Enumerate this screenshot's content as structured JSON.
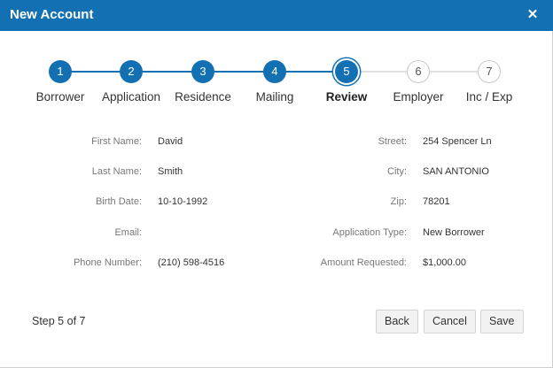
{
  "dialog": {
    "title": "New Account",
    "close_glyph": "✕"
  },
  "stepper": {
    "current_step": 5,
    "steps": [
      {
        "number": "1",
        "label": "Borrower",
        "state": "done"
      },
      {
        "number": "2",
        "label": "Application",
        "state": "done"
      },
      {
        "number": "3",
        "label": "Residence",
        "state": "done"
      },
      {
        "number": "4",
        "label": "Mailing",
        "state": "done"
      },
      {
        "number": "5",
        "label": "Review",
        "state": "current"
      },
      {
        "number": "6",
        "label": "Employer",
        "state": "todo"
      },
      {
        "number": "7",
        "label": "Inc / Exp",
        "state": "todo"
      }
    ]
  },
  "review": {
    "left": [
      {
        "label": "First Name:",
        "value": "David"
      },
      {
        "label": "Last Name:",
        "value": "Smith"
      },
      {
        "label": "Birth Date:",
        "value": "10-10-1992"
      },
      {
        "label": "Email:",
        "value": ""
      },
      {
        "label": "Phone Number:",
        "value": "(210) 598-4516"
      }
    ],
    "right": [
      {
        "label": "Street:",
        "value": "254 Spencer Ln"
      },
      {
        "label": "City:",
        "value": "SAN ANTONIO"
      },
      {
        "label": "Zip:",
        "value": "78201"
      },
      {
        "label": "Application Type:",
        "value": "New Borrower"
      },
      {
        "label": "Amount Requested:",
        "value": "$1,000.00"
      }
    ]
  },
  "footer": {
    "step_text": "Step 5 of 7",
    "back_label": "Back",
    "cancel_label": "Cancel",
    "save_label": "Save"
  },
  "colors": {
    "primary": "#1370b3",
    "inactive_line": "#e0e0e0"
  }
}
